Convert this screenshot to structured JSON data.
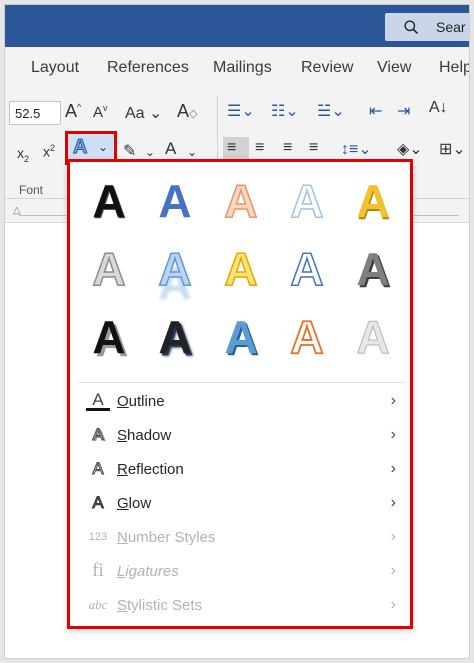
{
  "titlebar": {
    "search_label": "Sear",
    "accent": "#2b579a"
  },
  "tabs": [
    {
      "label": "Layout"
    },
    {
      "label": "References"
    },
    {
      "label": "Mailings"
    },
    {
      "label": "Review"
    },
    {
      "label": "View"
    },
    {
      "label": "Help"
    }
  ],
  "ribbon": {
    "font_size_value": "52.5",
    "group_label": "Font",
    "case_label": "Aa"
  },
  "wordart_gallery": {
    "rows": [
      [
        {
          "glyph": "A",
          "style": "black-fill"
        },
        {
          "glyph": "A",
          "style": "blue-fill"
        },
        {
          "glyph": "A",
          "style": "peach-outline"
        },
        {
          "glyph": "A",
          "style": "lightblue-outline"
        },
        {
          "glyph": "A",
          "style": "gold-fill"
        }
      ],
      [
        {
          "glyph": "A",
          "style": "gray-outline"
        },
        {
          "glyph": "A",
          "style": "blue-reflection"
        },
        {
          "glyph": "A",
          "style": "gold-outline"
        },
        {
          "glyph": "A",
          "style": "blue-outline"
        },
        {
          "glyph": "A",
          "style": "gray-bevel"
        }
      ],
      [
        {
          "glyph": "A",
          "style": "black-shadow"
        },
        {
          "glyph": "A",
          "style": "dark-shadow"
        },
        {
          "glyph": "A",
          "style": "blue-bevel"
        },
        {
          "glyph": "A",
          "style": "orange-outline"
        },
        {
          "glyph": "A",
          "style": "silver-gradient"
        }
      ]
    ]
  },
  "menu": [
    {
      "label": "Outline",
      "underline_char": "O",
      "rest": "utline",
      "icon": "outline-icon",
      "enabled": true
    },
    {
      "label": "Shadow",
      "underline_char": "S",
      "rest": "hadow",
      "icon": "shadow-icon",
      "enabled": true
    },
    {
      "label": "Reflection",
      "underline_char": "R",
      "rest": "eflection",
      "icon": "reflection-icon",
      "enabled": true
    },
    {
      "label": "Glow",
      "underline_char": "G",
      "rest": "low",
      "icon": "glow-icon",
      "enabled": true
    },
    {
      "label": "Number Styles",
      "underline_char": "N",
      "rest": "umber Styles",
      "icon": "number-styles-icon",
      "enabled": false,
      "icon_text": "123"
    },
    {
      "label": "Ligatures",
      "underline_char": "L",
      "rest": "igatures",
      "icon": "ligatures-icon",
      "enabled": false,
      "icon_text": "fi"
    },
    {
      "label": "Stylistic Sets",
      "underline_char": "S",
      "rest": "tylistic Sets",
      "icon": "stylistic-sets-icon",
      "enabled": false,
      "icon_text": "abc"
    }
  ],
  "colors": {
    "highlight_border": "#e00000",
    "ribbon_bg": "#f3f3f3"
  }
}
